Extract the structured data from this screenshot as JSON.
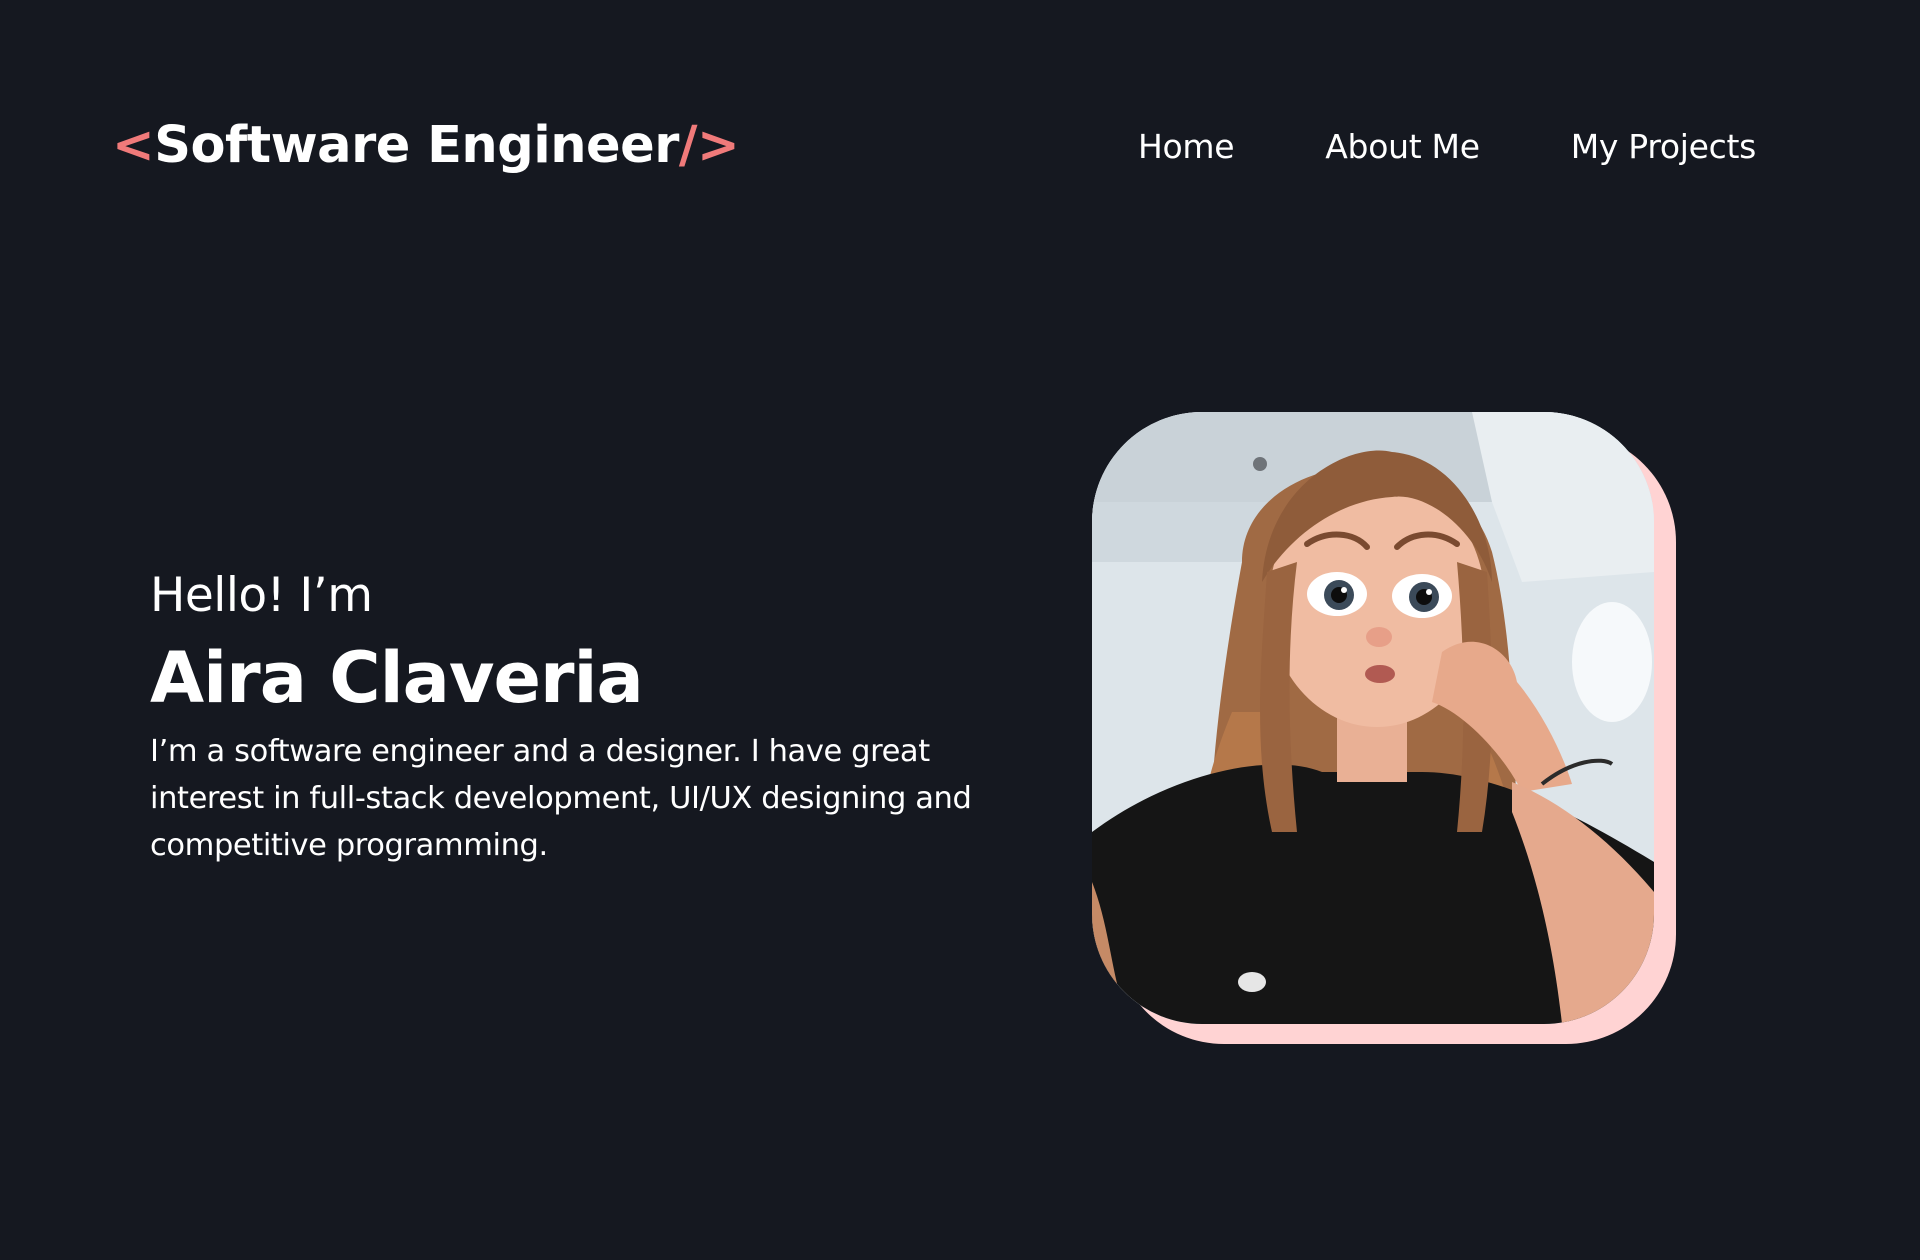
{
  "header": {
    "logo": {
      "open_bracket": "<",
      "text": "Software Engineer",
      "close_bracket": "/>"
    },
    "nav": [
      "Home",
      "About Me",
      "My Projects"
    ]
  },
  "hero": {
    "greeting": "Hello! I’m",
    "name": "Aira Claveria",
    "bio": "I’m a software engineer and a designer. I have great interest in full-stack development, UI/UX designing and competitive programming."
  },
  "colors": {
    "background": "#151820",
    "accent": "#f07a7a",
    "photo_frame": "#ffd3d3",
    "text": "#ffffff"
  }
}
